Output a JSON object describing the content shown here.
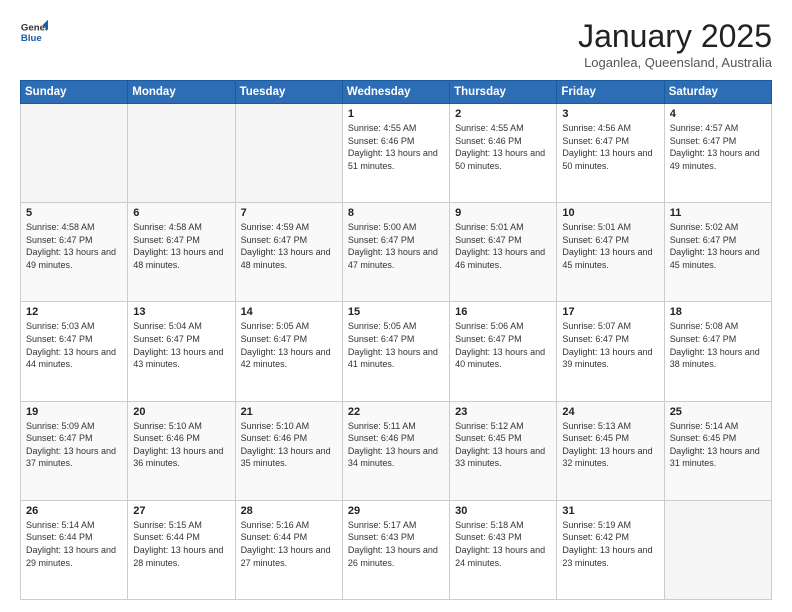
{
  "header": {
    "logo_general": "General",
    "logo_blue": "Blue",
    "month_title": "January 2025",
    "location": "Loganlea, Queensland, Australia"
  },
  "weekdays": [
    "Sunday",
    "Monday",
    "Tuesday",
    "Wednesday",
    "Thursday",
    "Friday",
    "Saturday"
  ],
  "weeks": [
    [
      {
        "day": "",
        "empty": true
      },
      {
        "day": "",
        "empty": true
      },
      {
        "day": "",
        "empty": true
      },
      {
        "day": "1",
        "sunrise": "Sunrise: 4:55 AM",
        "sunset": "Sunset: 6:46 PM",
        "daylight": "Daylight: 13 hours and 51 minutes."
      },
      {
        "day": "2",
        "sunrise": "Sunrise: 4:55 AM",
        "sunset": "Sunset: 6:46 PM",
        "daylight": "Daylight: 13 hours and 50 minutes."
      },
      {
        "day": "3",
        "sunrise": "Sunrise: 4:56 AM",
        "sunset": "Sunset: 6:47 PM",
        "daylight": "Daylight: 13 hours and 50 minutes."
      },
      {
        "day": "4",
        "sunrise": "Sunrise: 4:57 AM",
        "sunset": "Sunset: 6:47 PM",
        "daylight": "Daylight: 13 hours and 49 minutes."
      }
    ],
    [
      {
        "day": "5",
        "sunrise": "Sunrise: 4:58 AM",
        "sunset": "Sunset: 6:47 PM",
        "daylight": "Daylight: 13 hours and 49 minutes."
      },
      {
        "day": "6",
        "sunrise": "Sunrise: 4:58 AM",
        "sunset": "Sunset: 6:47 PM",
        "daylight": "Daylight: 13 hours and 48 minutes."
      },
      {
        "day": "7",
        "sunrise": "Sunrise: 4:59 AM",
        "sunset": "Sunset: 6:47 PM",
        "daylight": "Daylight: 13 hours and 48 minutes."
      },
      {
        "day": "8",
        "sunrise": "Sunrise: 5:00 AM",
        "sunset": "Sunset: 6:47 PM",
        "daylight": "Daylight: 13 hours and 47 minutes."
      },
      {
        "day": "9",
        "sunrise": "Sunrise: 5:01 AM",
        "sunset": "Sunset: 6:47 PM",
        "daylight": "Daylight: 13 hours and 46 minutes."
      },
      {
        "day": "10",
        "sunrise": "Sunrise: 5:01 AM",
        "sunset": "Sunset: 6:47 PM",
        "daylight": "Daylight: 13 hours and 45 minutes."
      },
      {
        "day": "11",
        "sunrise": "Sunrise: 5:02 AM",
        "sunset": "Sunset: 6:47 PM",
        "daylight": "Daylight: 13 hours and 45 minutes."
      }
    ],
    [
      {
        "day": "12",
        "sunrise": "Sunrise: 5:03 AM",
        "sunset": "Sunset: 6:47 PM",
        "daylight": "Daylight: 13 hours and 44 minutes."
      },
      {
        "day": "13",
        "sunrise": "Sunrise: 5:04 AM",
        "sunset": "Sunset: 6:47 PM",
        "daylight": "Daylight: 13 hours and 43 minutes."
      },
      {
        "day": "14",
        "sunrise": "Sunrise: 5:05 AM",
        "sunset": "Sunset: 6:47 PM",
        "daylight": "Daylight: 13 hours and 42 minutes."
      },
      {
        "day": "15",
        "sunrise": "Sunrise: 5:05 AM",
        "sunset": "Sunset: 6:47 PM",
        "daylight": "Daylight: 13 hours and 41 minutes."
      },
      {
        "day": "16",
        "sunrise": "Sunrise: 5:06 AM",
        "sunset": "Sunset: 6:47 PM",
        "daylight": "Daylight: 13 hours and 40 minutes."
      },
      {
        "day": "17",
        "sunrise": "Sunrise: 5:07 AM",
        "sunset": "Sunset: 6:47 PM",
        "daylight": "Daylight: 13 hours and 39 minutes."
      },
      {
        "day": "18",
        "sunrise": "Sunrise: 5:08 AM",
        "sunset": "Sunset: 6:47 PM",
        "daylight": "Daylight: 13 hours and 38 minutes."
      }
    ],
    [
      {
        "day": "19",
        "sunrise": "Sunrise: 5:09 AM",
        "sunset": "Sunset: 6:47 PM",
        "daylight": "Daylight: 13 hours and 37 minutes."
      },
      {
        "day": "20",
        "sunrise": "Sunrise: 5:10 AM",
        "sunset": "Sunset: 6:46 PM",
        "daylight": "Daylight: 13 hours and 36 minutes."
      },
      {
        "day": "21",
        "sunrise": "Sunrise: 5:10 AM",
        "sunset": "Sunset: 6:46 PM",
        "daylight": "Daylight: 13 hours and 35 minutes."
      },
      {
        "day": "22",
        "sunrise": "Sunrise: 5:11 AM",
        "sunset": "Sunset: 6:46 PM",
        "daylight": "Daylight: 13 hours and 34 minutes."
      },
      {
        "day": "23",
        "sunrise": "Sunrise: 5:12 AM",
        "sunset": "Sunset: 6:45 PM",
        "daylight": "Daylight: 13 hours and 33 minutes."
      },
      {
        "day": "24",
        "sunrise": "Sunrise: 5:13 AM",
        "sunset": "Sunset: 6:45 PM",
        "daylight": "Daylight: 13 hours and 32 minutes."
      },
      {
        "day": "25",
        "sunrise": "Sunrise: 5:14 AM",
        "sunset": "Sunset: 6:45 PM",
        "daylight": "Daylight: 13 hours and 31 minutes."
      }
    ],
    [
      {
        "day": "26",
        "sunrise": "Sunrise: 5:14 AM",
        "sunset": "Sunset: 6:44 PM",
        "daylight": "Daylight: 13 hours and 29 minutes."
      },
      {
        "day": "27",
        "sunrise": "Sunrise: 5:15 AM",
        "sunset": "Sunset: 6:44 PM",
        "daylight": "Daylight: 13 hours and 28 minutes."
      },
      {
        "day": "28",
        "sunrise": "Sunrise: 5:16 AM",
        "sunset": "Sunset: 6:44 PM",
        "daylight": "Daylight: 13 hours and 27 minutes."
      },
      {
        "day": "29",
        "sunrise": "Sunrise: 5:17 AM",
        "sunset": "Sunset: 6:43 PM",
        "daylight": "Daylight: 13 hours and 26 minutes."
      },
      {
        "day": "30",
        "sunrise": "Sunrise: 5:18 AM",
        "sunset": "Sunset: 6:43 PM",
        "daylight": "Daylight: 13 hours and 24 minutes."
      },
      {
        "day": "31",
        "sunrise": "Sunrise: 5:19 AM",
        "sunset": "Sunset: 6:42 PM",
        "daylight": "Daylight: 13 hours and 23 minutes."
      },
      {
        "day": "",
        "empty": true
      }
    ]
  ]
}
